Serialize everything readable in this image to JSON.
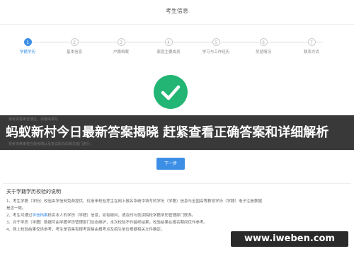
{
  "header": {
    "title": "考生信息"
  },
  "steps": [
    {
      "number": "1",
      "label": "学籍学历",
      "active": true
    },
    {
      "number": "2",
      "label": "基本信息",
      "active": false
    },
    {
      "number": "3",
      "label": "户籍档案",
      "active": false
    },
    {
      "number": "4",
      "label": "家庭主要成员",
      "active": false
    },
    {
      "number": "5",
      "label": "学习与工作经历",
      "active": false
    },
    {
      "number": "6",
      "label": "奖惩情况",
      "active": false
    },
    {
      "number": "7",
      "label": "联系方式",
      "active": false
    }
  ],
  "banner": {
    "title": "蚂蚁新村今日最新答案揭晓 赶紧查看正确答案和详细解析",
    "faint_line_1": "报考资格审查通过，请继续填写",
    "faint_line_2": "报考资格审查在报考确认及复试阶段由相关部门进行。"
  },
  "next_button": {
    "label": "下一步"
  },
  "notes": {
    "heading": "关于学籍学历校验的说明",
    "lines": [
      "1、考生学籍（学历）校验由学信网免费提供，仅用来校验考生在网上报名系统中填写的学历（学籍）信息与全国高等教育学历（学籍）电子注册数据",
      "是否一致。",
      "2、考生可通过",
      "学信档案",
      "核实本人的学历（学籍）信息，如有疑问，请及时与就读院校学籍学历管理部门联系。",
      "3、对于学历（学籍）数据可由学籍学历管理部门动态维护，本次校验不作最终结果，校验结果在报名期间仅作参考。",
      "4、网上校验结果仅供参考，考生是否具有报考资格由报考点及招生单位根据相关文件确定。"
    ]
  },
  "watermark": {
    "text": "www.iweben.com"
  },
  "colors": {
    "accent": "#3d8fe6",
    "success": "#22b573",
    "banner_bg": "#181818"
  }
}
